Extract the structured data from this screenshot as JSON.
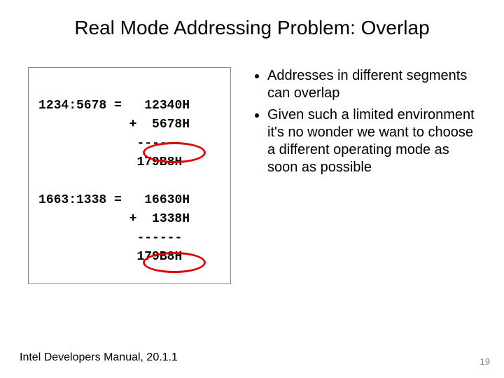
{
  "title": "Real Mode Addressing Problem: Overlap",
  "code": {
    "ex1": {
      "addr": "1234:5678 =",
      "shifted": "12340H",
      "plus": "+  5678H",
      "sep": "------",
      "result": "179B8H"
    },
    "ex2": {
      "addr": "1663:1338 =",
      "shifted": "16630H",
      "plus": "+  1338H",
      "sep": "------",
      "result": "179B8H"
    }
  },
  "bullets": [
    "Addresses in different segments can overlap",
    "Given such a limited environment it's no wonder we want to choose a different operating mode as soon as possible"
  ],
  "footer": "Intel  Developers Manual, 20.1.1",
  "page": "19"
}
